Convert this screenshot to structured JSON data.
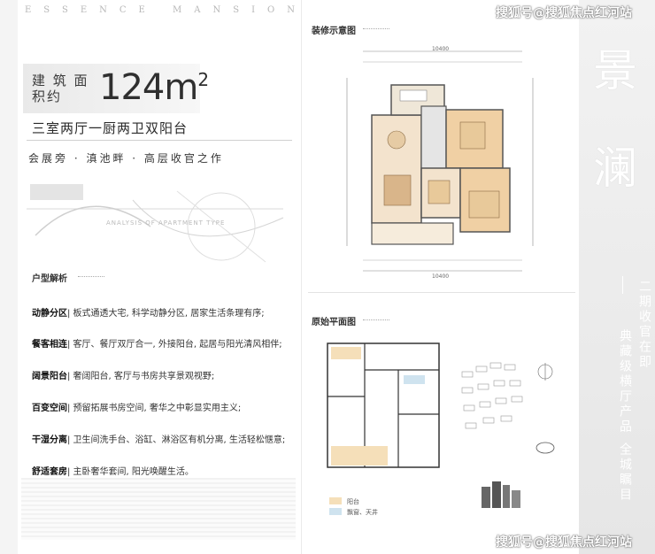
{
  "brand": "ESSENCE MANSION",
  "area": {
    "label": "建 筑 面积约",
    "value": "124m",
    "sup": "2"
  },
  "layout_title": "三室两厅一厨两卫双阳台",
  "slogan": "会展旁 · 滇池畔 · 高层收官之作",
  "sketch_caption": "ANALYSIS OF APARTMENT TYPE",
  "analysis_heading": "户型解析",
  "features": [
    {
      "key": "动静分区",
      "text": "| 板式通透大宅, 科学动静分区, 居家生活条理有序;"
    },
    {
      "key": "餐客相连",
      "text": "| 客厅、餐厅双厅合一, 外接阳台, 起居与阳光清风相伴;"
    },
    {
      "key": "阔景阳台",
      "text": "| 奢阔阳台, 客厅与书房共享景观视野;"
    },
    {
      "key": "百变空间",
      "text": "| 预留拓展书房空间, 奢华之中彰显实用主义;"
    },
    {
      "key": "干湿分离",
      "text": "| 卫生间洗手台、浴缸、淋浴区有机分离, 生活轻松惬意;"
    },
    {
      "key": "舒适套房",
      "text": "| 主卧奢华套间, 阳光唤醒生活。"
    }
  ],
  "plan_top_heading": "装修示意图",
  "plan_bottom_heading": "原始平面图",
  "dim_top": "10400",
  "dim_bottom": "10400",
  "legend": [
    {
      "label": "阳台",
      "color": "#f5dfb9"
    },
    {
      "label": "飘窗、天井",
      "color": "#cfe3ef"
    }
  ],
  "right_big_chars": [
    "景",
    "澜"
  ],
  "right_vertical_1": "二期收官在即",
  "right_vertical_2": "典藏级横厅产品",
  "right_vertical_3": "全城瞩目",
  "watermark": "搜狐号@搜狐焦点红河站"
}
